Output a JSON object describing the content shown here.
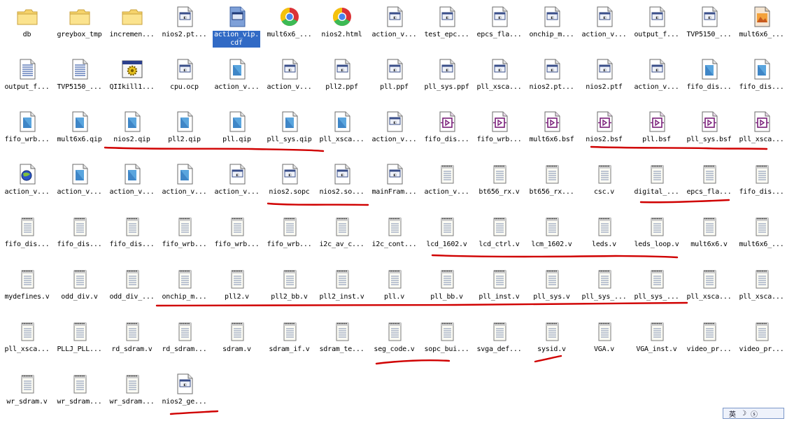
{
  "files": [
    {
      "label": "db",
      "icon": "folder-icon"
    },
    {
      "label": "greybox_tmp",
      "icon": "folder-icon"
    },
    {
      "label": "incremen...",
      "icon": "folder-icon"
    },
    {
      "label": "nios2.pt...",
      "icon": "app-file-icon"
    },
    {
      "label": "action_vip.cdf",
      "icon": "cdf-file-icon",
      "selected": true
    },
    {
      "label": "mult6x6_...",
      "icon": "chrome-icon"
    },
    {
      "label": "nios2.html",
      "icon": "chrome-icon"
    },
    {
      "label": "action_v...",
      "icon": "app-file-icon"
    },
    {
      "label": "test_epc...",
      "icon": "app-file-icon"
    },
    {
      "label": "epcs_fla...",
      "icon": "app-file-icon"
    },
    {
      "label": "onchip_m...",
      "icon": "app-file-icon"
    },
    {
      "label": "action_v...",
      "icon": "app-file-icon"
    },
    {
      "label": "output_f...",
      "icon": "app-file-icon"
    },
    {
      "label": "TVP5150_...",
      "icon": "app-file-icon"
    },
    {
      "label": "mult6x6_...",
      "icon": "image-file-icon"
    },
    {
      "label": "output_f...",
      "icon": "text-doc-icon"
    },
    {
      "label": "TVP5150_...",
      "icon": "text-doc-icon"
    },
    {
      "label": "QIIkill1...",
      "icon": "gear-window-icon"
    },
    {
      "label": "cpu.ocp",
      "icon": "app-file-icon"
    },
    {
      "label": "action_v...",
      "icon": "blue-doc-icon"
    },
    {
      "label": "action_v...",
      "icon": "app-file-icon"
    },
    {
      "label": "pll2.ppf",
      "icon": "app-file-icon"
    },
    {
      "label": "pll.ppf",
      "icon": "app-file-icon"
    },
    {
      "label": "pll_sys.ppf",
      "icon": "app-file-icon"
    },
    {
      "label": "pll_xsca...",
      "icon": "app-file-icon"
    },
    {
      "label": "nios2.pt...",
      "icon": "app-file-icon"
    },
    {
      "label": "nios2.ptf",
      "icon": "app-file-icon"
    },
    {
      "label": "action_v...",
      "icon": "app-file-icon"
    },
    {
      "label": "fifo_dis...",
      "icon": "blue-doc-icon"
    },
    {
      "label": "fifo_dis...",
      "icon": "blue-doc-icon"
    },
    {
      "label": "fifo_wrb...",
      "icon": "blue-doc-icon"
    },
    {
      "label": "mult6x6.qip",
      "icon": "blue-doc-icon"
    },
    {
      "label": "nios2.qip",
      "icon": "blue-doc-icon"
    },
    {
      "label": "pll2.qip",
      "icon": "blue-doc-icon"
    },
    {
      "label": "pll.qip",
      "icon": "blue-doc-icon"
    },
    {
      "label": "pll_sys.qip",
      "icon": "blue-doc-icon"
    },
    {
      "label": "pll_xsca...",
      "icon": "blue-doc-icon"
    },
    {
      "label": "action_v...",
      "icon": "app-file-icon"
    },
    {
      "label": "fifo_dis...",
      "icon": "symbol-file-icon"
    },
    {
      "label": "fifo_wrb...",
      "icon": "symbol-file-icon"
    },
    {
      "label": "mult6x6.bsf",
      "icon": "symbol-file-icon"
    },
    {
      "label": "nios2.bsf",
      "icon": "symbol-file-icon"
    },
    {
      "label": "pll.bsf",
      "icon": "symbol-file-icon"
    },
    {
      "label": "pll_sys.bsf",
      "icon": "symbol-file-icon"
    },
    {
      "label": "pll_xsca...",
      "icon": "symbol-file-icon"
    },
    {
      "label": "action_v...",
      "icon": "web-doc-icon"
    },
    {
      "label": "action_v...",
      "icon": "blue-doc-icon"
    },
    {
      "label": "action_v...",
      "icon": "blue-doc-icon"
    },
    {
      "label": "action_v...",
      "icon": "blue-doc-icon"
    },
    {
      "label": "action_v...",
      "icon": "app-file-icon"
    },
    {
      "label": "nios2.sopc",
      "icon": "app-file-icon"
    },
    {
      "label": "nios2.so...",
      "icon": "app-file-icon"
    },
    {
      "label": "mainFram...",
      "icon": "app-file-icon"
    },
    {
      "label": "action_v...",
      "icon": "notepad-icon"
    },
    {
      "label": "bt656_rx.v",
      "icon": "notepad-icon"
    },
    {
      "label": "bt656_rx...",
      "icon": "notepad-icon"
    },
    {
      "label": "csc.v",
      "icon": "notepad-icon"
    },
    {
      "label": "digital_...",
      "icon": "notepad-icon"
    },
    {
      "label": "epcs_fla...",
      "icon": "notepad-icon"
    },
    {
      "label": "fifo_dis...",
      "icon": "notepad-icon"
    },
    {
      "label": "fifo_dis...",
      "icon": "notepad-icon"
    },
    {
      "label": "fifo_dis...",
      "icon": "notepad-icon"
    },
    {
      "label": "fifo_dis...",
      "icon": "notepad-icon"
    },
    {
      "label": "fifo_wrb...",
      "icon": "notepad-icon"
    },
    {
      "label": "fifo_wrb...",
      "icon": "notepad-icon"
    },
    {
      "label": "fifo_wrb...",
      "icon": "notepad-icon"
    },
    {
      "label": "i2c_av_c...",
      "icon": "notepad-icon"
    },
    {
      "label": "i2c_cont...",
      "icon": "notepad-icon"
    },
    {
      "label": "lcd_1602.v",
      "icon": "notepad-icon"
    },
    {
      "label": "lcd_ctrl.v",
      "icon": "notepad-icon"
    },
    {
      "label": "lcm_1602.v",
      "icon": "notepad-icon"
    },
    {
      "label": "leds.v",
      "icon": "notepad-icon"
    },
    {
      "label": "leds_loop.v",
      "icon": "notepad-icon"
    },
    {
      "label": "mult6x6.v",
      "icon": "notepad-icon"
    },
    {
      "label": "mult6x6_...",
      "icon": "notepad-icon"
    },
    {
      "label": "mydefines.v",
      "icon": "notepad-icon"
    },
    {
      "label": "odd_div.v",
      "icon": "notepad-icon"
    },
    {
      "label": "odd_div_...",
      "icon": "notepad-icon"
    },
    {
      "label": "onchip_m...",
      "icon": "notepad-icon"
    },
    {
      "label": "pll2.v",
      "icon": "notepad-icon"
    },
    {
      "label": "pll2_bb.v",
      "icon": "notepad-icon"
    },
    {
      "label": "pll2_inst.v",
      "icon": "notepad-icon"
    },
    {
      "label": "pll.v",
      "icon": "notepad-icon"
    },
    {
      "label": "pll_bb.v",
      "icon": "notepad-icon"
    },
    {
      "label": "pll_inst.v",
      "icon": "notepad-icon"
    },
    {
      "label": "pll_sys.v",
      "icon": "notepad-icon"
    },
    {
      "label": "pll_sys_...",
      "icon": "notepad-icon"
    },
    {
      "label": "pll_sys_...",
      "icon": "notepad-icon"
    },
    {
      "label": "pll_xsca...",
      "icon": "notepad-icon"
    },
    {
      "label": "pll_xsca...",
      "icon": "notepad-icon"
    },
    {
      "label": "pll_xsca...",
      "icon": "notepad-icon"
    },
    {
      "label": "PLLJ_PLL...",
      "icon": "notepad-icon"
    },
    {
      "label": "rd_sdram.v",
      "icon": "notepad-icon"
    },
    {
      "label": "rd_sdram...",
      "icon": "notepad-icon"
    },
    {
      "label": "sdram.v",
      "icon": "notepad-icon"
    },
    {
      "label": "sdram_if.v",
      "icon": "notepad-icon"
    },
    {
      "label": "sdram_te...",
      "icon": "notepad-icon"
    },
    {
      "label": "seg_code.v",
      "icon": "notepad-icon"
    },
    {
      "label": "sopc_bui...",
      "icon": "notepad-icon"
    },
    {
      "label": "svga_def...",
      "icon": "notepad-icon"
    },
    {
      "label": "sysid.v",
      "icon": "notepad-icon"
    },
    {
      "label": "VGA.v",
      "icon": "notepad-icon"
    },
    {
      "label": "VGA_inst.v",
      "icon": "notepad-icon"
    },
    {
      "label": "video_pr...",
      "icon": "notepad-icon"
    },
    {
      "label": "video_pr...",
      "icon": "notepad-icon"
    },
    {
      "label": "wr_sdram.v",
      "icon": "notepad-icon"
    },
    {
      "label": "wr_sdram...",
      "icon": "notepad-icon"
    },
    {
      "label": "wr_sdram...",
      "icon": "notepad-icon"
    },
    {
      "label": "nios2_ge...",
      "icon": "app-file-icon"
    }
  ],
  "colors": {
    "annotation": "#d00000",
    "selection": "#316ac5",
    "folder": "#f5d36b",
    "symbol": "#7a1f7a"
  },
  "ime": {
    "mode": "英",
    "moon": "☽",
    "extra": "ⓢ"
  }
}
